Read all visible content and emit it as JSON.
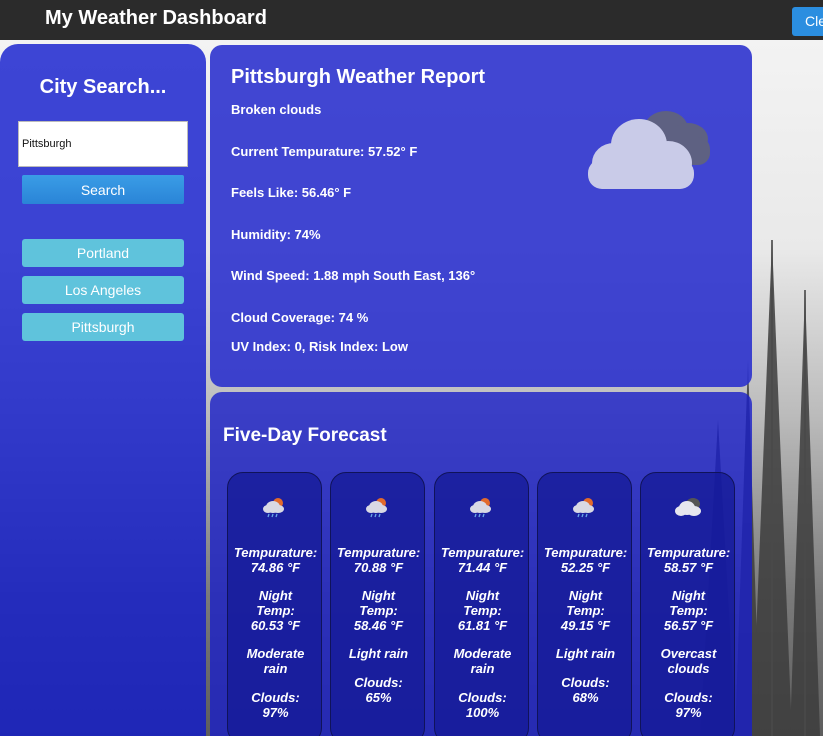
{
  "header": {
    "title": "My Weather Dashboard",
    "clear_label": "Cle"
  },
  "sidebar": {
    "title": "City Search...",
    "search_value": "Pittsburgh",
    "search_button": "Search",
    "history": [
      "Portland",
      "Los Angeles",
      "Pittsburgh"
    ]
  },
  "report": {
    "title": "Pittsburgh Weather Report",
    "description": "Broken clouds",
    "temperature": "Current Tempurature: 57.52° F",
    "feels_like": "Feels Like: 56.46° F",
    "humidity": "Humidity: 74%",
    "wind": "Wind Speed: 1.88 mph South East, 136°",
    "clouds": "Cloud Coverage: 74 %",
    "uv": "UV Index: 0, Risk Index: Low",
    "icon": "broken-clouds-icon"
  },
  "forecast": {
    "title": "Five-Day Forecast",
    "days": [
      {
        "temp_label": "Tempurature:",
        "temp": "74.86 °F",
        "night_label_1": "Night",
        "night_label_2": "Temp:",
        "night_temp": "60.53 °F",
        "desc_1": "Moderate",
        "desc_2": "rain",
        "clouds_label": "Clouds:",
        "clouds": "97%",
        "icon": "rain-icon"
      },
      {
        "temp_label": "Tempurature:",
        "temp": "70.88 °F",
        "night_label_1": "Night",
        "night_label_2": "Temp:",
        "night_temp": "58.46 °F",
        "desc_1": "Light rain",
        "desc_2": "",
        "clouds_label": "Clouds:",
        "clouds": "65%",
        "icon": "rain-icon"
      },
      {
        "temp_label": "Tempurature:",
        "temp": "71.44 °F",
        "night_label_1": "Night",
        "night_label_2": "Temp:",
        "night_temp": "61.81 °F",
        "desc_1": "Moderate",
        "desc_2": "rain",
        "clouds_label": "Clouds:",
        "clouds": "100%",
        "icon": "rain-icon"
      },
      {
        "temp_label": "Tempurature:",
        "temp": "52.25 °F",
        "night_label_1": "Night",
        "night_label_2": "Temp:",
        "night_temp": "49.15 °F",
        "desc_1": "Light rain",
        "desc_2": "",
        "clouds_label": "Clouds:",
        "clouds": "68%",
        "icon": "rain-icon"
      },
      {
        "temp_label": "Tempurature:",
        "temp": "58.57 °F",
        "night_label_1": "Night",
        "night_label_2": "Temp:",
        "night_temp": "56.57 °F",
        "desc_1": "Overcast",
        "desc_2": "clouds",
        "clouds_label": "Clouds:",
        "clouds": "97%",
        "icon": "overcast-clouds-icon"
      }
    ]
  }
}
